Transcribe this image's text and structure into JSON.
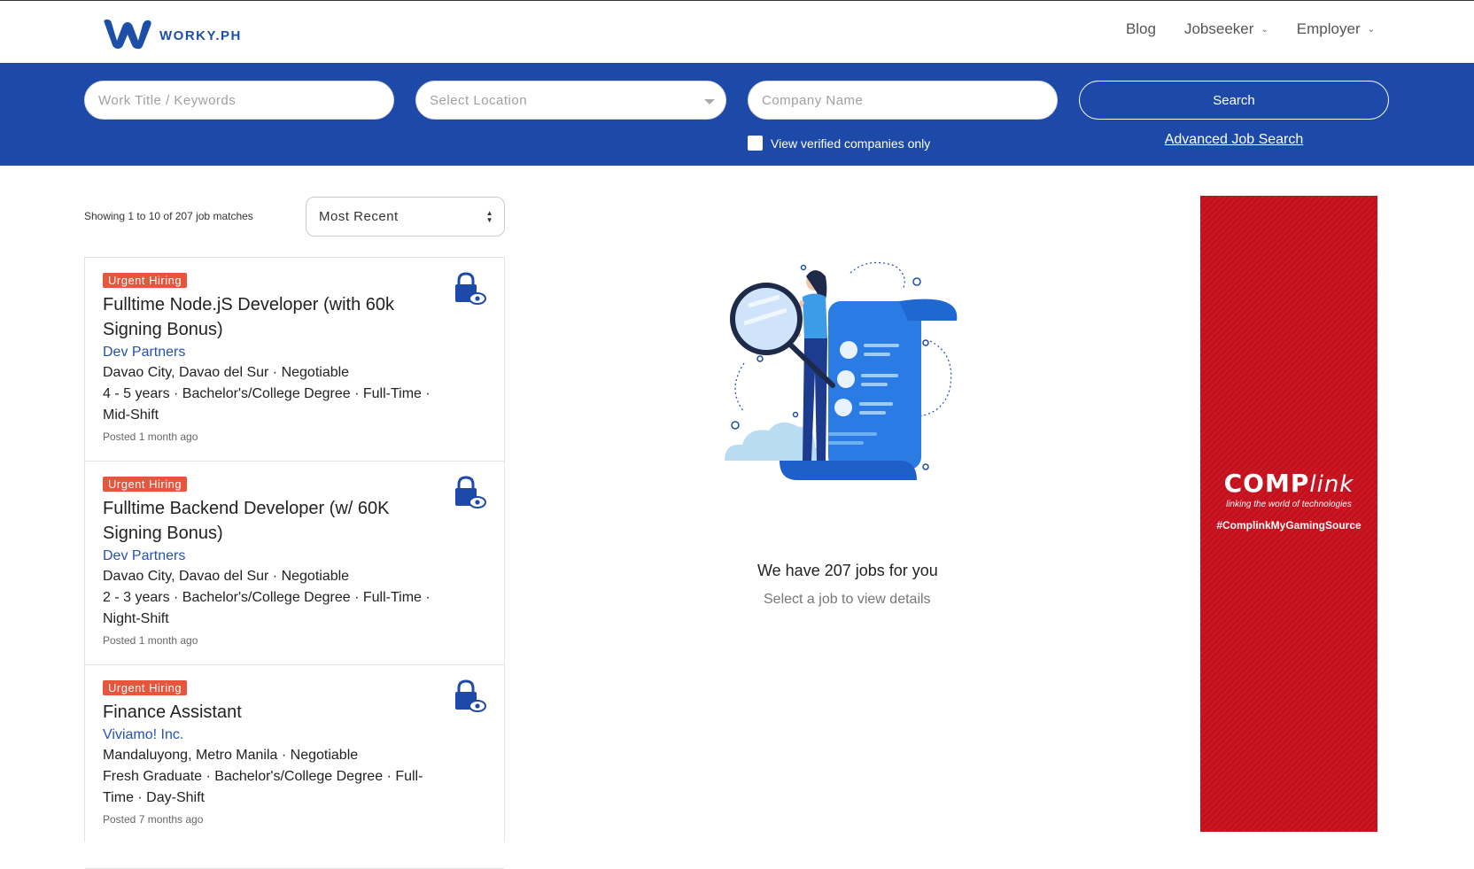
{
  "header": {
    "logo_text": "WORKY.PH",
    "nav": [
      {
        "label": "Blog",
        "dropdown": false
      },
      {
        "label": "Jobseeker",
        "dropdown": true
      },
      {
        "label": "Employer",
        "dropdown": true
      }
    ]
  },
  "search": {
    "keywords_placeholder": "Work Title / Keywords",
    "location_placeholder": "Select Location",
    "company_placeholder": "Company Name",
    "search_label": "Search",
    "verified_label": "View verified companies only",
    "verified_checked": false,
    "advanced_label": "Advanced Job Search"
  },
  "results": {
    "showing_text": "Showing 1 to 10 of 207 job matches",
    "sort_selected": "Most Recent"
  },
  "jobs": [
    {
      "badge": "Urgent Hiring",
      "title": "Fulltime Node.jS Developer (with 60k Signing Bonus)",
      "company": "Dev Partners",
      "location_salary": "Davao City, Davao del Sur · Negotiable",
      "details": "4 - 5 years · Bachelor's/College Degree · Full-Time · Mid-Shift",
      "posted": "Posted 1 month ago"
    },
    {
      "badge": "Urgent Hiring",
      "title": "Fulltime Backend Developer (w/ 60K Signing Bonus)",
      "company": "Dev Partners",
      "location_salary": "Davao City, Davao del Sur · Negotiable",
      "details": "2 - 3 years · Bachelor's/College Degree · Full-Time · Night-Shift",
      "posted": "Posted 1 month ago"
    },
    {
      "badge": "Urgent Hiring",
      "title": "Finance Assistant",
      "company": "Viviamo! Inc.",
      "location_salary": "Mandaluyong, Metro Manila · Negotiable",
      "details": "Fresh Graduate · Bachelor's/College Degree · Full-Time · Day-Shift",
      "posted": "Posted 7 months ago"
    }
  ],
  "empty_state": {
    "title": "We have 207 jobs for you",
    "subtitle": "Select a job to view details"
  },
  "ad": {
    "brand_main": "COMP",
    "brand_italic": "link",
    "tagline": "linking the world of technologies",
    "hashtag": "#ComplinkMyGamingSource"
  },
  "colors": {
    "brand_blue": "#1d4aa8",
    "badge_red": "#e5563c",
    "ad_red": "#c8111e",
    "link_blue": "#2451b5"
  }
}
